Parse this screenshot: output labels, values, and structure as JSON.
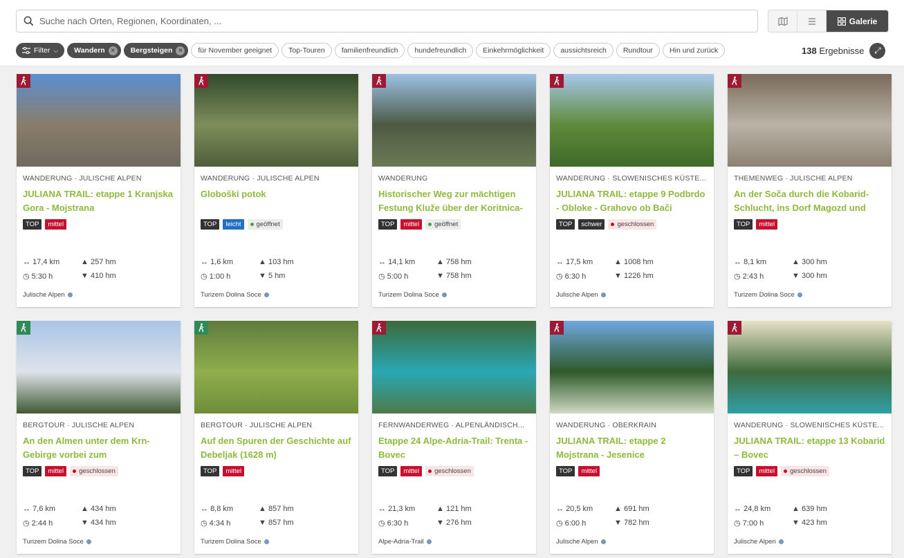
{
  "search": {
    "placeholder": "Suche nach Orten, Regionen, Koordinaten, ..."
  },
  "view_switch": {
    "map_icon": "map-icon",
    "list_icon": "list-icon",
    "gallery_label": "Galerie"
  },
  "filters": {
    "filter_label": "Filter",
    "active": [
      "Wandern",
      "Bergsteigen"
    ],
    "chips": [
      "für November geeignet",
      "Top-Touren",
      "familienfreundlich",
      "hundefreundlich",
      "Einkehrmöglichkeit",
      "aussichtsreich",
      "Rundtour",
      "Hin und zurück"
    ]
  },
  "results": {
    "count": "138",
    "label": "Ergebnisse"
  },
  "colors": {
    "title_green": "#8dba3e",
    "difficulty_red": "#c8102e",
    "hiking_cat": "#9b1b35",
    "mountain_cat": "#2e8b57"
  },
  "cards": [
    {
      "kicker": "WANDERUNG · JULISCHE ALPEN",
      "title": "JULIANA TRAIL: etappe 1 Kranjska Gora - Mojstrana",
      "top": "TOP",
      "difficulty": "mittel",
      "status": "",
      "distance": "17,4 km",
      "ascent": "257 hm",
      "duration": "5:30 h",
      "descent": "410 hm",
      "owner": "Julische Alpen"
    },
    {
      "kicker": "WANDERUNG · JULISCHE ALPEN",
      "title": "Globoški potok",
      "top": "TOP",
      "difficulty": "leicht",
      "status": "geöffnet",
      "distance": "1,6 km",
      "ascent": "103 hm",
      "duration": "1:00 h",
      "descent": "5 hm",
      "owner": "Turizem Dolina Soce"
    },
    {
      "kicker": "WANDERUNG",
      "title": "Historischer Weg zur mächtigen Festung Kluže über der Koritnica-",
      "top": "TOP",
      "difficulty": "mittel",
      "status": "geöffnet",
      "distance": "14,1 km",
      "ascent": "758 hm",
      "duration": "5:00 h",
      "descent": "758 hm",
      "owner": "Turizem Dolina Soce"
    },
    {
      "kicker": "WANDERUNG · SLOWENISCHES KÜSTE...",
      "title": "JULIANA TRAIL: etappe 9 Podbrdo - Obloke - Grahovo ob Bači",
      "top": "TOP",
      "difficulty": "schwer",
      "status": "geschlossen",
      "distance": "17,5 km",
      "ascent": "1008 hm",
      "duration": "6:30 h",
      "descent": "1226 hm",
      "owner": "Julische Alpen"
    },
    {
      "kicker": "THEMENWEG · JULISCHE ALPEN",
      "title": "An der Soča durch die Kobarid-Schlucht, ins Dorf Magozd und",
      "top": "TOP",
      "difficulty": "mittel",
      "status": "",
      "distance": "8,1 km",
      "ascent": "300 hm",
      "duration": "2:43 h",
      "descent": "300 hm",
      "owner": "Turizem Dolina Soce"
    },
    {
      "kicker": "BERGTOUR · JULISCHE ALPEN",
      "title": "An den Almen unter dem Krn-Gebirge vorbei zum",
      "top": "TOP",
      "difficulty": "mittel",
      "status": "geschlossen",
      "distance": "7,6 km",
      "ascent": "434 hm",
      "duration": "2:44 h",
      "descent": "434 hm",
      "owner": "Turizem Dolina Soce"
    },
    {
      "kicker": "BERGTOUR · JULISCHE ALPEN",
      "title": "Auf den Spuren der Geschichte auf Debeljak (1628 m)",
      "top": "TOP",
      "difficulty": "mittel",
      "status": "",
      "distance": "8,8 km",
      "ascent": "857 hm",
      "duration": "4:34 h",
      "descent": "857 hm",
      "owner": "Turizem Dolina Soce"
    },
    {
      "kicker": "FERNWANDERWEG · ALPENLÄNDISCH...",
      "title": "Etappe 24 Alpe-Adria-Trail: Trenta - Bovec",
      "top": "TOP",
      "difficulty": "mittel",
      "status": "geschlossen",
      "distance": "21,3 km",
      "ascent": "121 hm",
      "duration": "6:30 h",
      "descent": "276 hm",
      "owner": "Alpe-Adria-Trail"
    },
    {
      "kicker": "WANDERUNG · OBERKRAIN",
      "title": "JULIANA TRAIL: etappe 2 Mojstrana - Jesenice",
      "top": "TOP",
      "difficulty": "mittel",
      "status": "",
      "distance": "20,5 km",
      "ascent": "691 hm",
      "duration": "6:00 h",
      "descent": "782 hm",
      "owner": "Julische Alpen"
    },
    {
      "kicker": "WANDERUNG · SLOWENISCHES KÜSTE...",
      "title": "JULIANA TRAIL: etappe 13 Kobarid – Bovec",
      "top": "TOP",
      "difficulty": "mittel",
      "status": "geschlossen",
      "distance": "24,8 km",
      "ascent": "639 hm",
      "duration": "7:00 h",
      "descent": "423 hm",
      "owner": "Julische Alpen"
    }
  ]
}
